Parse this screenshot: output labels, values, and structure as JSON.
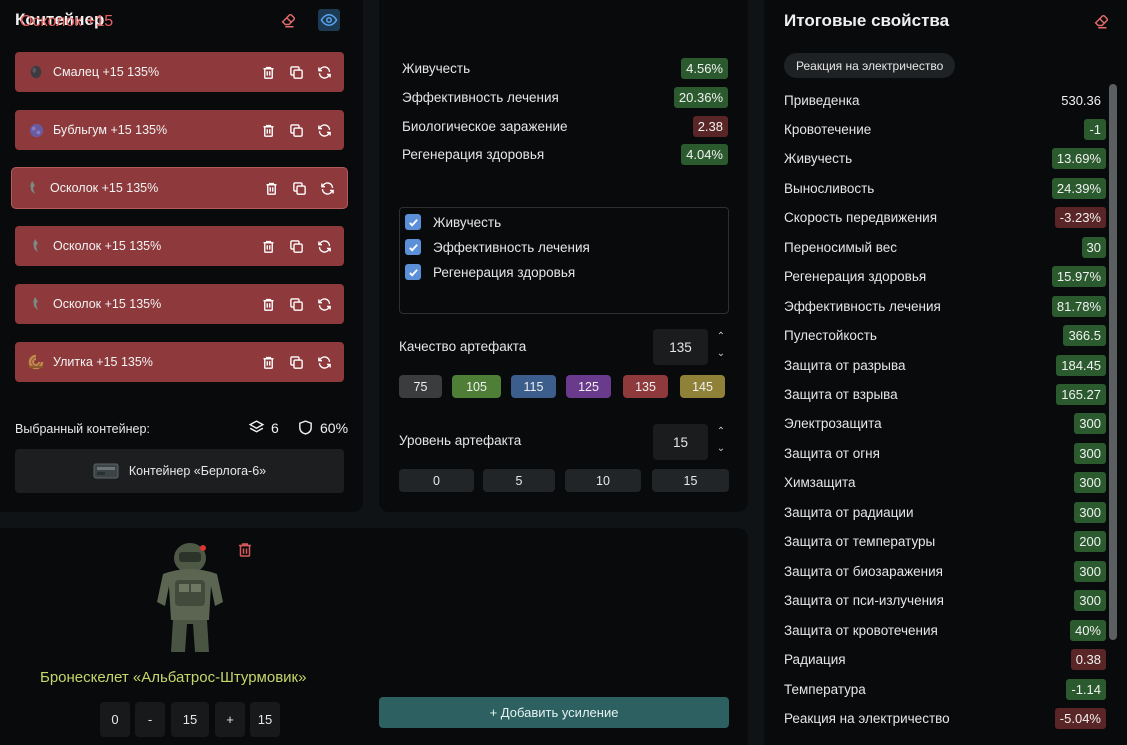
{
  "container": {
    "title": "Контейнер",
    "items": [
      {
        "label": "Смалец +15 135%",
        "icon": "smalets-artifact-icon"
      },
      {
        "label": "Бубльгум +15 135%",
        "icon": "bubblegum-artifact-icon"
      },
      {
        "label": "Осколок +15 135%",
        "icon": "shard-artifact-icon",
        "selected": true
      },
      {
        "label": "Осколок +15 135%",
        "icon": "shard-artifact-icon"
      },
      {
        "label": "Осколок +15 135%",
        "icon": "shard-artifact-icon"
      },
      {
        "label": "Улитка +15 135%",
        "icon": "snail-artifact-icon"
      }
    ],
    "selected_label": "Выбранный контейнер:",
    "slots": "6",
    "protection": "60%",
    "container_name": "Контейнер «Берлога-6»"
  },
  "artifact": {
    "title": "Осколок +15",
    "stats": [
      {
        "name": "Живучесть",
        "value": "4.56%",
        "tone": "g"
      },
      {
        "name": "Эффективность лечения",
        "value": "20.36%",
        "tone": "g"
      },
      {
        "name": "Биологическое заражение",
        "value": "2.38",
        "tone": "r"
      },
      {
        "name": "Регенерация здоровья",
        "value": "4.04%",
        "tone": "g"
      }
    ],
    "checks": [
      "Живучесть",
      "Эффективность лечения",
      "Регенерация здоровья"
    ],
    "quality_label": "Качество артефакта",
    "quality_value": "135",
    "quality_options": [
      {
        "label": "75",
        "color": "#3a3c3e"
      },
      {
        "label": "105",
        "color": "#4f7e37"
      },
      {
        "label": "115",
        "color": "#3b5e8c"
      },
      {
        "label": "125",
        "color": "#6a3b8c"
      },
      {
        "label": "135",
        "color": "#8e3a3d"
      },
      {
        "label": "145",
        "color": "#8f8137"
      }
    ],
    "level_label": "Уровень артефакта",
    "level_value": "15",
    "level_options": [
      "0",
      "5",
      "10",
      "15"
    ]
  },
  "suit": {
    "name": "Бронескелет «Альбатрос-Штурмовик»",
    "min": "0",
    "minus": "-",
    "value": "15",
    "plus": "+",
    "max": "15",
    "add_button": "+ Добавить усиление"
  },
  "totals": {
    "title": "Итоговые свойства",
    "chip": "Реакция на электричество",
    "rows": [
      {
        "name": "Приведенка",
        "value": "530.36",
        "tone": "plain"
      },
      {
        "name": "Кровотечение",
        "value": "-1",
        "tone": "g"
      },
      {
        "name": "Живучесть",
        "value": "13.69%",
        "tone": "g"
      },
      {
        "name": "Выносливость",
        "value": "24.39%",
        "tone": "g"
      },
      {
        "name": "Скорость передвижения",
        "value": "-3.23%",
        "tone": "r"
      },
      {
        "name": "Переносимый вес",
        "value": "30",
        "tone": "g"
      },
      {
        "name": "Регенерация здоровья",
        "value": "15.97%",
        "tone": "g"
      },
      {
        "name": "Эффективность лечения",
        "value": "81.78%",
        "tone": "g"
      },
      {
        "name": "Пулестойкость",
        "value": "366.5",
        "tone": "g"
      },
      {
        "name": "Защита от разрыва",
        "value": "184.45",
        "tone": "g"
      },
      {
        "name": "Защита от взрыва",
        "value": "165.27",
        "tone": "g"
      },
      {
        "name": "Электрозащита",
        "value": "300",
        "tone": "g"
      },
      {
        "name": "Защита от огня",
        "value": "300",
        "tone": "g"
      },
      {
        "name": "Химзащита",
        "value": "300",
        "tone": "g"
      },
      {
        "name": "Защита от радиации",
        "value": "300",
        "tone": "g"
      },
      {
        "name": "Защита от температуры",
        "value": "200",
        "tone": "g"
      },
      {
        "name": "Защита от биозаражения",
        "value": "300",
        "tone": "g"
      },
      {
        "name": "Защита от пси-излучения",
        "value": "300",
        "tone": "g"
      },
      {
        "name": "Защита от кровотечения",
        "value": "40%",
        "tone": "g"
      },
      {
        "name": "Радиация",
        "value": "0.38",
        "tone": "r"
      },
      {
        "name": "Температура",
        "value": "-1.14",
        "tone": "g"
      },
      {
        "name": "Реакция на электричество",
        "value": "-5.04%",
        "tone": "r"
      }
    ]
  }
}
